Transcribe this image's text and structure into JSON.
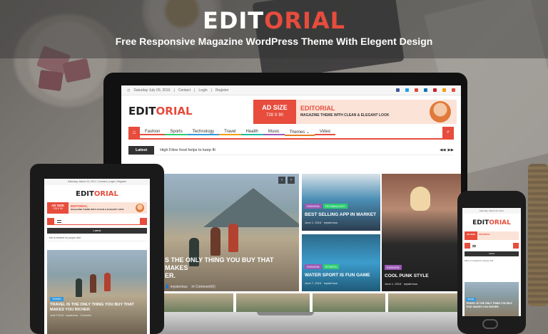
{
  "hero": {
    "title_part1": "EDIT",
    "title_part2": "ORIAL",
    "subtitle": "Free Responsive Magazine WordPress Theme With Elegent Design"
  },
  "colors": {
    "accent": "#e74c3c",
    "dark": "#333333"
  },
  "site": {
    "date": "Saturday July 09, 2016",
    "top_links": [
      "Contact",
      "Login",
      "Register"
    ],
    "logo_part1": "EDIT",
    "logo_part2": "ORIAL",
    "ad": {
      "size_label": "AD SIZE",
      "dimensions": "728 X 90",
      "brand": "EDITORIAL",
      "tagline": "MAGAZINE THEME WITH CLEAN & ELEGANT LOOK"
    },
    "nav": [
      "Fashion",
      "Sports",
      "Technology",
      "Travel",
      "Health",
      "Music",
      "Themes ⌄",
      "Video"
    ],
    "ticker_label": "Latest",
    "ticker_text": "High Fibre food helps to keep fit",
    "main_post": {
      "title": "S THE ONLY THING YOU BUY THAT MAKES",
      "title2": "ER.",
      "author": "mysterious",
      "comments": "Comment(0)"
    },
    "cards": [
      {
        "tags": [
          "FASHION",
          "TECHNOLOGY"
        ],
        "title": "BEST SELLING APP IN MARKET",
        "date": "June 1, 2016",
        "author": "mysterious"
      },
      {
        "tags": [
          "FASHION",
          "SPORTS"
        ],
        "title": "WATER SPORT IS FUN GAME",
        "date": "June 7, 2016",
        "author": "mysterious"
      },
      {
        "tags": [
          "FASHION"
        ],
        "title": "COOL PUNK STYLE",
        "date": "June 1, 2016",
        "author": "mysterious"
      }
    ]
  },
  "tablet": {
    "top": "Saturday, March 24, 2017  |  Contact  |  Login  |  Register",
    "logo_part1": "EDIT",
    "logo_part2": "ORIAL",
    "ad_size": "AD SIZE",
    "ad_dim": "728 X 90",
    "ad_brand": "EDITORIAL",
    "ad_tagline": "MAGAZINE THEME WITH CLEAN & ELEGANT LOOK",
    "latest": "Latest",
    "ticker": "...bre is needed for proper diet",
    "post_tag": "TRAVEL",
    "post_title": "TRAVEL IS THE ONLY THING YOU BUY THAT MAKES YOU RICHER.",
    "post_meta": "June 3 2016  ·  mysterious  ·  Comment"
  },
  "phone": {
    "top": "Saturday, March 24, 2017",
    "logo_part1": "EDIT",
    "logo_part2": "ORIAL",
    "ad_size": "AD SIZE",
    "ad_brand": "EDITORIAL",
    "latest": "Latest",
    "ticker": "Fibre is needed for proper diet",
    "post_tag": "TRAVEL",
    "post_title": "TRAVEL IS THE ONLY THING YOU BUY THAT MAKES YOU RICHER."
  }
}
